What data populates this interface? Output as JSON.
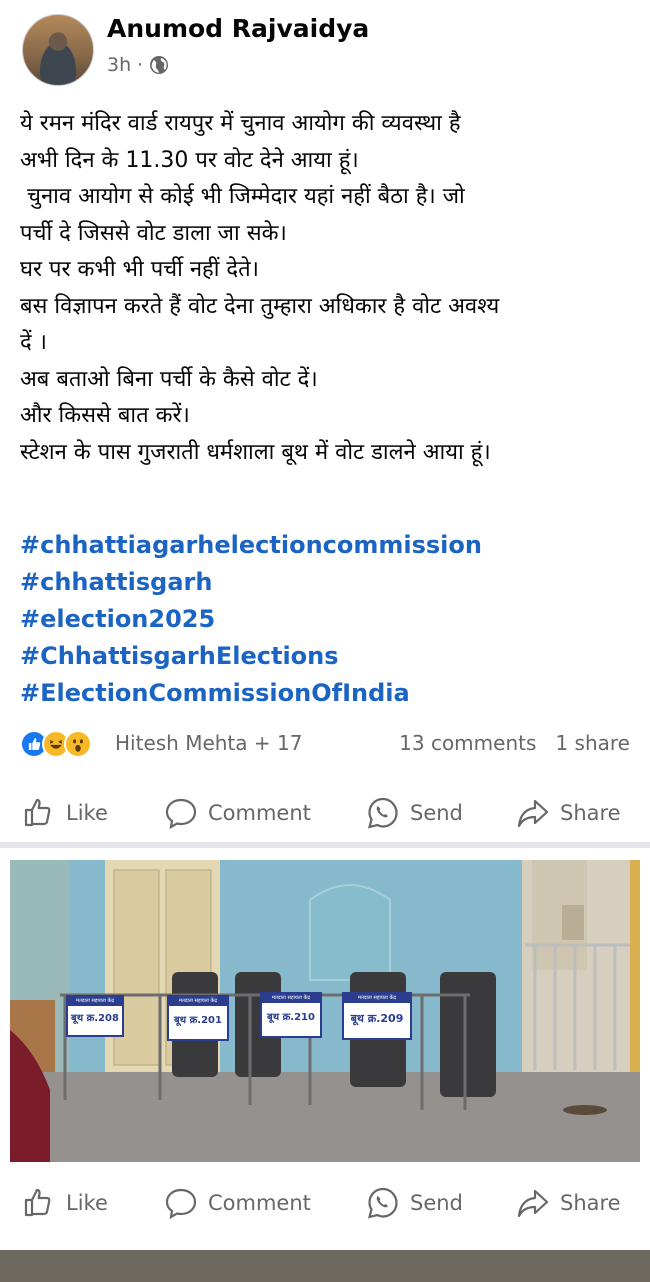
{
  "post": {
    "author": "Anumod Rajvaidya",
    "time": "3h",
    "separator": "·",
    "text_lines": [
      "ये रमन मंदिर वार्ड रायपुर में चुनाव आयोग की व्यवस्था है",
      "अभी दिन के 11.30 पर वोट देने आया हूं।",
      " चुनाव आयोग से कोई भी जिम्मेदार यहां नहीं बैठा है। जो",
      "पर्ची दे जिससे वोट डाला जा सके।",
      "घर पर कभी भी पर्ची नहीं देते।",
      "बस विज्ञापन करते हैं वोट देना तुम्हारा अधिकार है वोट अवश्य",
      "दें ।",
      "अब बताओ बिना पर्ची के कैसे वोट दें।",
      "और किससे बात करें।",
      "स्टेशन के पास गुजराती धर्मशाला बूथ में वोट डालने आया हूं।"
    ],
    "hashtags": [
      "#chhattiagarhelectioncommission",
      "#chhattisgarh",
      "#election2025",
      "#ChhattisgarhElections",
      "#ElectionCommissionOfIndia"
    ]
  },
  "reactions": {
    "icons": [
      "like-reaction-icon",
      "haha-reaction-icon",
      "wow-reaction-icon"
    ],
    "names": "Hitesh Mehta + 17",
    "comments": "13 comments",
    "shares": "1 share"
  },
  "actions": {
    "like": "Like",
    "comment": "Comment",
    "send": "Send",
    "share": "Share"
  },
  "photo": {
    "booth_signs": [
      {
        "header": "मतदाता सहायता केंद्र",
        "label": "बूथ क्र.208"
      },
      {
        "header": "मतदाता सहायता केंद्र",
        "label": "बूथ क्र.201"
      },
      {
        "header": "मतदाता सहायता केंद्र",
        "label": "बूथ क्र.210"
      },
      {
        "header": "मतदाता सहायता केंद्र",
        "label": "बूथ क्र.209"
      }
    ]
  },
  "colors": {
    "hashtag": "#1b64c4",
    "secondary_text": "#65676b",
    "like_blue": "#1877f2"
  }
}
